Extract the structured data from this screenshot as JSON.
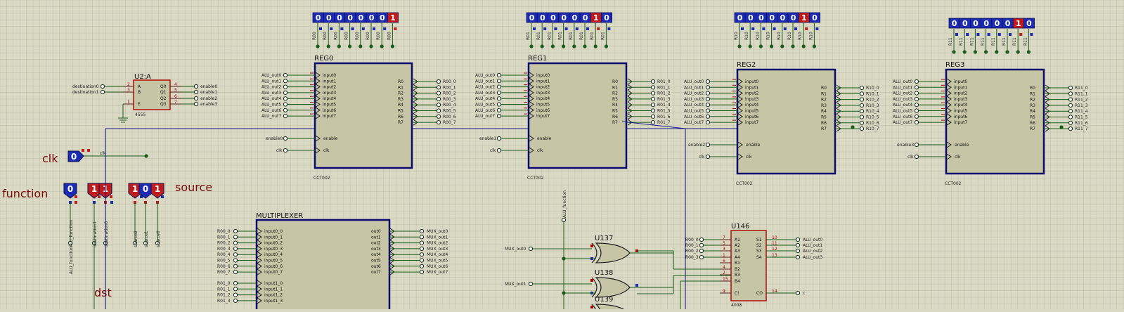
{
  "labels": {
    "clk": "clk",
    "function": "function",
    "source": "source",
    "dst": "dst"
  },
  "state_boxes": {
    "clk": "0",
    "function": [
      "0",
      "1",
      "1"
    ],
    "source": [
      "1",
      "0",
      "1"
    ]
  },
  "bottom_nets": [
    "ALU_function",
    "destination1",
    "destination0",
    "source2",
    "source1",
    "source0"
  ],
  "decoder": {
    "ref": "U2:A",
    "part": "4555",
    "in_pins": [
      "A",
      "B",
      "E"
    ],
    "out_pins": [
      "Q0",
      "Q1",
      "Q2",
      "Q3"
    ],
    "in_nums": [
      "2",
      "3",
      "1"
    ],
    "out_nums": [
      "4",
      "5",
      "6",
      "7"
    ],
    "in_nets": [
      "destination0",
      "destination1"
    ],
    "out_nets": [
      "enable0",
      "enable1",
      "enable2",
      "enable3"
    ]
  },
  "registers": [
    {
      "name": "REG0",
      "part": "CCT002",
      "enable_net": "enable0",
      "bits": [
        "0",
        "0",
        "0",
        "0",
        "0",
        "0",
        "0",
        "1"
      ],
      "out_nets": [
        "R00_0",
        "R00_1",
        "R00_2",
        "R00_3",
        "R00_4",
        "R00_5",
        "R00_6",
        "R00_7"
      ],
      "top_nets": [
        "R00",
        "R00",
        "R00",
        "R00",
        "R00",
        "R00",
        "R00",
        "R00"
      ]
    },
    {
      "name": "REG1",
      "part": "CCT002",
      "enable_net": "enable1",
      "bits": [
        "0",
        "0",
        "0",
        "0",
        "0",
        "0",
        "1",
        "0"
      ],
      "out_nets": [
        "R01_0",
        "R01_1",
        "R01_2",
        "R01_3",
        "R01_4",
        "R01_5",
        "R01_6",
        "R01_7"
      ],
      "top_nets": [
        "R01",
        "R01",
        "R01",
        "R01",
        "R01",
        "R01",
        "R01",
        "R01"
      ]
    },
    {
      "name": "REG2",
      "part": "CCT002",
      "enable_net": "enable2",
      "bits": [
        "0",
        "0",
        "0",
        "0",
        "0",
        "0",
        "1",
        "0"
      ],
      "out_nets": [
        "R10_0",
        "R10_1",
        "R10_2",
        "R10_3",
        "R10_4",
        "R10_5",
        "R10_6",
        "R10_7"
      ],
      "top_nets": [
        "R10",
        "R10",
        "R10",
        "R10",
        "R10",
        "R10",
        "R10",
        "R10"
      ]
    },
    {
      "name": "REG3",
      "part": "CCT002",
      "enable_net": "enable3",
      "bits": [
        "0",
        "0",
        "0",
        "0",
        "0",
        "0",
        "1",
        "0"
      ],
      "out_nets": [
        "R11_0",
        "R11_1",
        "R11_2",
        "R11_3",
        "R11_4",
        "R11_5",
        "R11_6",
        "R11_7"
      ],
      "top_nets": [
        "R11",
        "R11",
        "R11",
        "R11",
        "R11",
        "R11",
        "R11",
        "R11"
      ]
    }
  ],
  "reg_common": {
    "in_nets": [
      "ALU_out0",
      "ALU_out1",
      "ALU_out2",
      "ALU_out3",
      "ALU_out4",
      "ALU_out5",
      "ALU_out6",
      "ALU_out7"
    ],
    "in_pins": [
      "input0",
      "input1",
      "input2",
      "input3",
      "input4",
      "input5",
      "input6",
      "input7"
    ],
    "out_pins": [
      "R0",
      "R1",
      "R2",
      "R3",
      "R4",
      "R5",
      "R6",
      "R7"
    ],
    "enable_pin": "enable",
    "clk_pin": "clk",
    "clk_net": "clk"
  },
  "mux": {
    "name": "MULTIPLEXER",
    "in_pins0": [
      "input0_0",
      "input0_1",
      "input0_2",
      "input0_3",
      "input0_4",
      "input0_5",
      "input0_6",
      "input0_7"
    ],
    "in_nets0": [
      "R00_0",
      "R00_1",
      "R00_2",
      "R00_3",
      "R00_4",
      "R00_5",
      "R00_6",
      "R00_7"
    ],
    "in_pins1": [
      "input1_0",
      "input1_1",
      "input1_2",
      "input1_3"
    ],
    "in_nets1": [
      "R01_0",
      "R01_1",
      "R01_2",
      "R01_3"
    ],
    "out_pins": [
      "out0",
      "out1",
      "out2",
      "out3",
      "out4",
      "out5",
      "out6",
      "out7"
    ],
    "out_nets": [
      "MUX_out0",
      "MUX_out1",
      "MUX_out2",
      "MUX_out3",
      "MUX_out4",
      "MUX_out5",
      "MUX_out6",
      "MUX_out7"
    ]
  },
  "xor_gates": {
    "refs": [
      "U137",
      "U138",
      "U139"
    ],
    "nets": [
      "MUX_out0",
      "MUX_out1"
    ],
    "func_net": "ALU_function"
  },
  "adder": {
    "ref": "U146",
    "part": "4008",
    "in_pins": [
      "A1",
      "A2",
      "A3",
      "A4",
      "B1",
      "B2",
      "B3",
      "B4",
      "CI"
    ],
    "in_nums": [
      "7",
      "5",
      "3",
      "1",
      "6",
      "4",
      "2",
      "15",
      "9"
    ],
    "in_nets": [
      "R00_0",
      "R00_1",
      "R00_2",
      "R00_3"
    ],
    "out_pins": [
      "S1",
      "S2",
      "S3",
      "S4",
      "CO"
    ],
    "out_nums": [
      "10",
      "11",
      "12",
      "13",
      "14"
    ],
    "out_nets": [
      "ALU_out0",
      "ALU_out1",
      "ALU_out2",
      "ALU_out3",
      "c"
    ]
  },
  "colors": {
    "bg": "#d9d9c4",
    "grid": "#c4c4ae",
    "wire": "#1a5c1a",
    "bus": "#1a1a8c",
    "chip": "#c6c6a6",
    "reg_border": "#0b0b6e",
    "accent_red": "#b00000",
    "state_blue": "#1c2bb4",
    "state_red": "#bf1d1d",
    "pin": "#5a2020"
  }
}
